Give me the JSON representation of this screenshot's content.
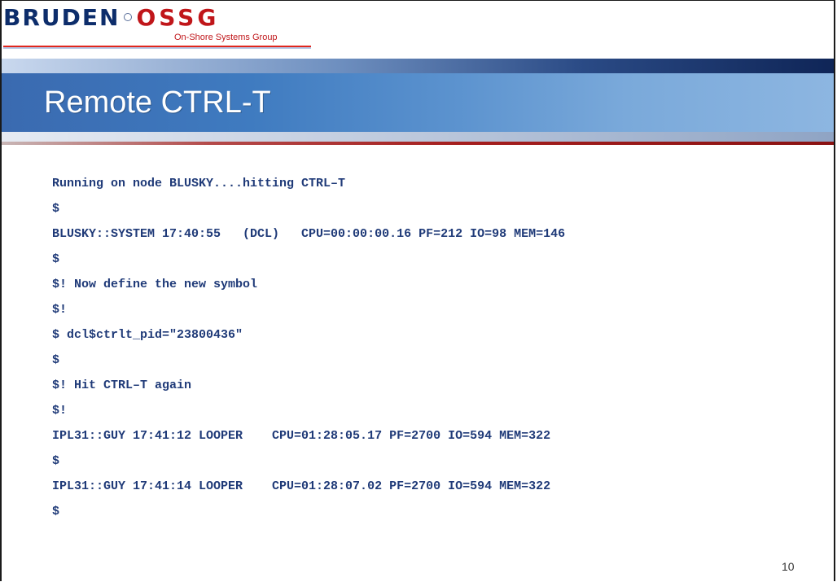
{
  "logo": {
    "brand_left": "BRUDEN",
    "brand_right": "OSSG",
    "subtitle": "On-Shore Systems Group"
  },
  "slide": {
    "title": "Remote CTRL-T",
    "page_number": "10"
  },
  "console_lines": [
    "Running on node BLUSKY....hitting CTRL–T",
    "$",
    "BLUSKY::SYSTEM 17:40:55   (DCL)   CPU=00:00:00.16 PF=212 IO=98 MEM=146",
    "$",
    "$! Now define the new symbol",
    "$!",
    "$ dcl$ctrlt_pid=\"23800436\"",
    "$",
    "$! Hit CTRL–T again",
    "$!",
    "IPL31::GUY 17:41:12 LOOPER    CPU=01:28:05.17 PF=2700 IO=594 MEM=322",
    "$",
    "IPL31::GUY 17:41:14 LOOPER    CPU=01:28:07.02 PF=2700 IO=594 MEM=322",
    "$"
  ],
  "colors": {
    "brand_blue": "#0d2d6b",
    "brand_red": "#c0161a",
    "console_text": "#1f3a78"
  }
}
